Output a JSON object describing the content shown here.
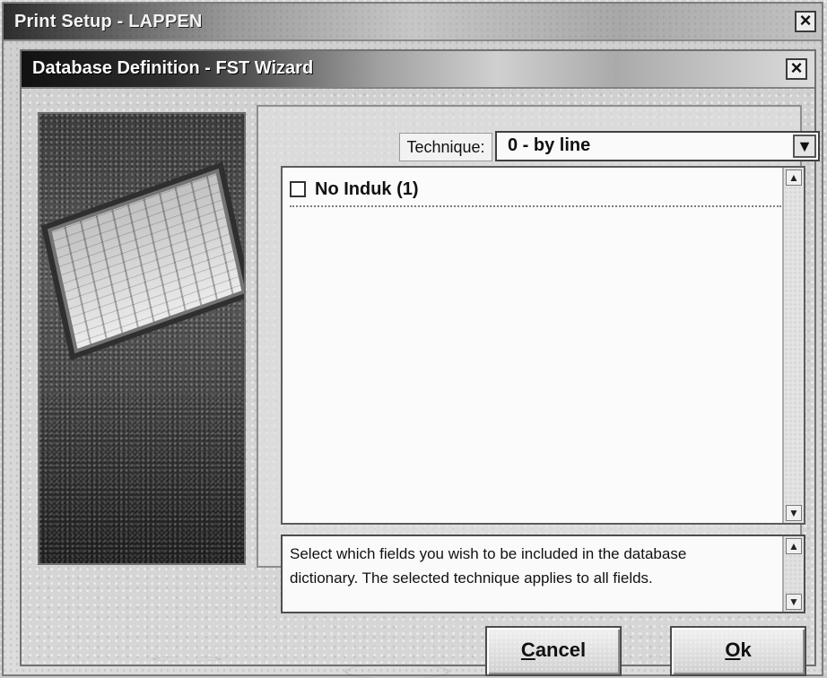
{
  "outer_window": {
    "title": "Print Setup - LAPPEN",
    "close_label": "×"
  },
  "dialog": {
    "title": "Database Definition - FST Wizard",
    "close_label": "×",
    "technique_label": "Technique:",
    "technique_value": "0 - by line",
    "technique_arrow": "▼",
    "fields": [
      {
        "label": "No Induk (1)",
        "checked": false
      }
    ],
    "help_text": "Select which fields you wish to be included in the database\ndictionary. The selected technique applies to all fields.",
    "buttons": {
      "cancel": "Cancel",
      "ok": "Ok"
    },
    "scroll": {
      "up": "▲",
      "down": "▼"
    }
  }
}
